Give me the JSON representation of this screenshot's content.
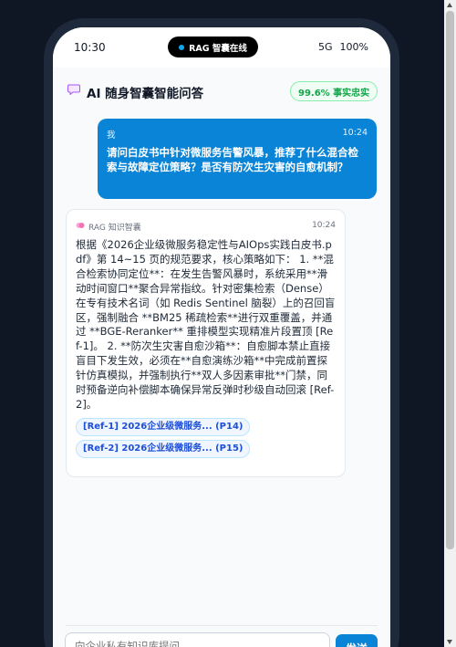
{
  "status_bar": {
    "time": "10:30",
    "island_label": "RAG 智囊在线",
    "signal": "5G",
    "battery": "100%"
  },
  "header": {
    "logo_icon": "speech-bubble",
    "title": "AI 随身智囊智能问答",
    "badge": "99.6% 事实忠实"
  },
  "messages": {
    "user": {
      "sender": "我",
      "time": "10:24",
      "text": "请问白皮书中针对微服务告警风暴，推荐了什么混合检索与故障定位策略？是否有防次生灾害的自愈机制？"
    },
    "ai": {
      "sender": "RAG 知识智囊",
      "avatar_icon": "brain",
      "time": "10:24",
      "text": "根据《2026企业级微服务稳定性与AIOps实践白皮书.pdf》第 14~15 页的规范要求，核心策略如下： 1. **混合检索协同定位**：在发生告警风暴时，系统采用**滑动时间窗口**聚合异常指纹。针对密集检索（Dense）在专有技术名词（如 Redis Sentinel 脑裂）上的召回盲区，强制融合 **BM25 稀疏检索**进行双重覆盖，并通过 **BGE-Reranker** 重排模型实现精准片段置顶 [Ref-1]。 2. **防次生灾害自愈沙箱**：自愈脚本禁止直接盲目下发生效，必须在**自愈演练沙箱**中完成前置探针仿真模拟，并强制执行**双人多因素审批**门禁，同时预备逆向补偿脚本确保异常反弹时秒级自动回滚 [Ref-2]。",
      "refs": [
        "[Ref-1] 2026企业级微服务... (P14)",
        "[Ref-2] 2026企业级微服务... (P15)"
      ]
    }
  },
  "composer": {
    "placeholder": "向企业私有知识库提问...",
    "send_label": "发送"
  },
  "colors": {
    "accent": "#0a84d6",
    "phone_frame": "#1e293b",
    "background": "#0f1724",
    "badge_green": "#16a34a"
  }
}
